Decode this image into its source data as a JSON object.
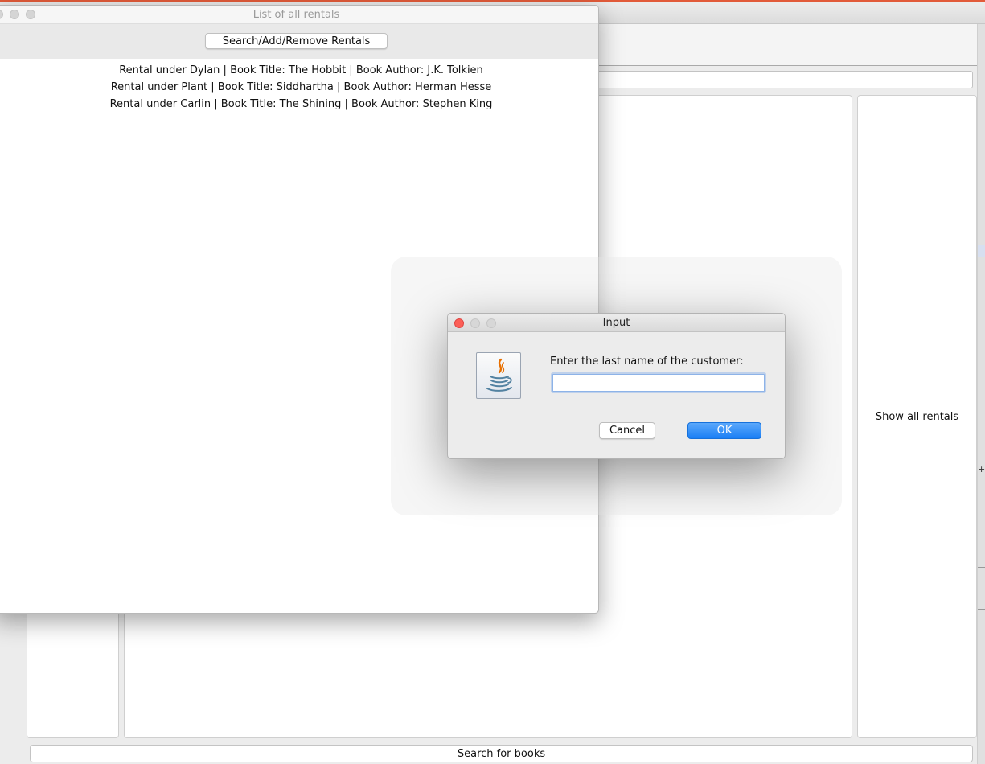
{
  "main_window": {
    "show_all_rentals_label": "Show all rentals",
    "search_books_label": "Search for books"
  },
  "rentals_window": {
    "title": "List of all rentals",
    "search_button_label": "Search/Add/Remove Rentals",
    "rentals": [
      "Rental under Dylan | Book Title: The Hobbit | Book Author: J.K. Tolkien",
      "Rental under Plant | Book Title: Siddhartha | Book Author: Herman Hesse",
      "Rental under Carlin | Book Title: The Shining | Book Author: Stephen King"
    ]
  },
  "dialog": {
    "title": "Input",
    "prompt": "Enter the last name of the customer:",
    "input_value": "",
    "cancel_label": "Cancel",
    "ok_label": "OK",
    "icon": "java-icon"
  },
  "colors": {
    "ok_button": "#1a7ff5",
    "close_light": "#fc5f57",
    "accent_bar": "#e25b3a"
  }
}
